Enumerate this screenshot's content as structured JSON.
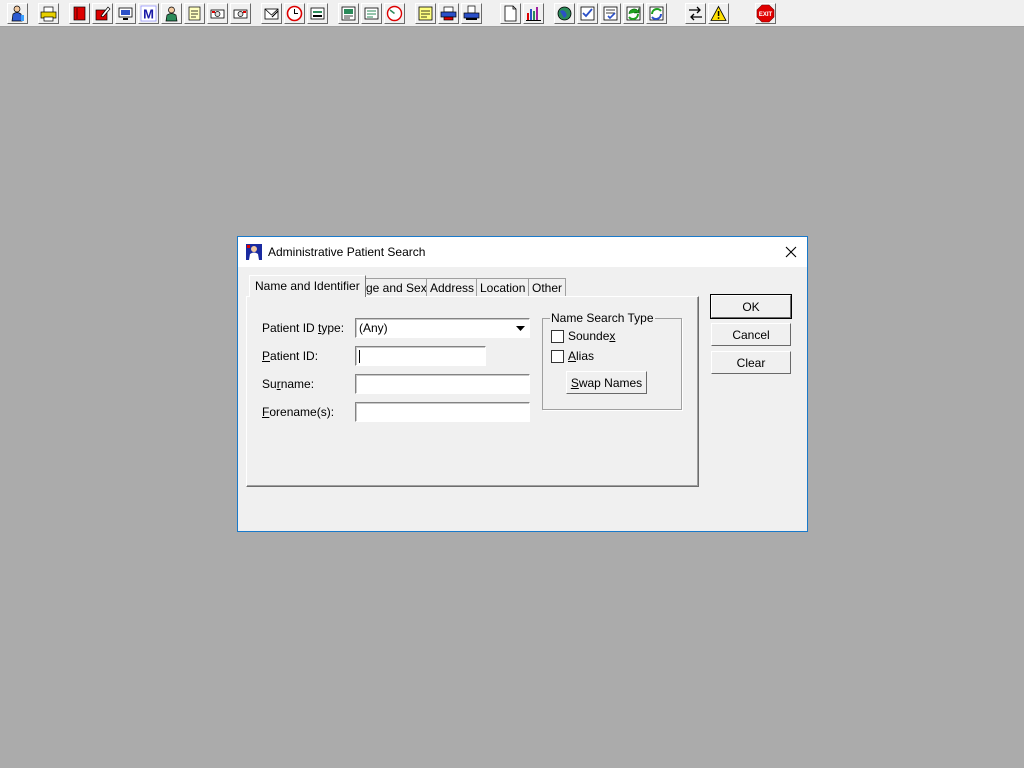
{
  "toolbar": {
    "icons": [
      "patient-icon",
      "print-icon",
      "book-icon",
      "edit-icon",
      "monitor-icon",
      "m-icon",
      "doctor-icon",
      "notepad-icon",
      "camera-icon",
      "camera2-icon",
      "envelope-icon",
      "clock-icon",
      "tray-icon",
      "chart-doc-icon",
      "form-icon",
      "gauge-icon",
      "sticky-note-icon",
      "printer2-icon",
      "scanner-icon",
      "document-icon",
      "bar-chart-icon",
      "globe-icon",
      "checklist-icon",
      "checklist2-icon",
      "refresh-green-icon",
      "refresh-green2-icon",
      "swap-arrows-icon",
      "warning-icon",
      "exit-icon"
    ],
    "exit_label": "EXIT"
  },
  "dialog": {
    "title": "Administrative Patient Search",
    "tabs": [
      "Name and Identifier",
      "Age and Sex",
      "Address",
      "Location",
      "Other"
    ],
    "active_tab": "Name and Identifier",
    "fields": {
      "patient_id_type": {
        "label_pre": "Patient ID ",
        "label_u": "t",
        "label_post": "ype:",
        "value": "(Any)"
      },
      "patient_id": {
        "label_pre": "",
        "label_u": "P",
        "label_post": "atient ID:",
        "value": ""
      },
      "surname": {
        "label_pre": "Su",
        "label_u": "r",
        "label_post": "name:",
        "value": ""
      },
      "forenames": {
        "label_pre": "",
        "label_u": "F",
        "label_post": "orename(s):",
        "value": ""
      }
    },
    "name_search_type": {
      "title": "Name Search Type",
      "soundex": {
        "label_pre": "Sounde",
        "label_u": "x",
        "label_post": "",
        "checked": false
      },
      "alias": {
        "label_pre": "",
        "label_u": "A",
        "label_post": "lias",
        "checked": false
      },
      "swap_button": {
        "label_pre": "",
        "label_u": "S",
        "label_post": "wap Names"
      }
    },
    "buttons": {
      "ok": "OK",
      "cancel": "Cancel",
      "clear": "Clear"
    }
  }
}
